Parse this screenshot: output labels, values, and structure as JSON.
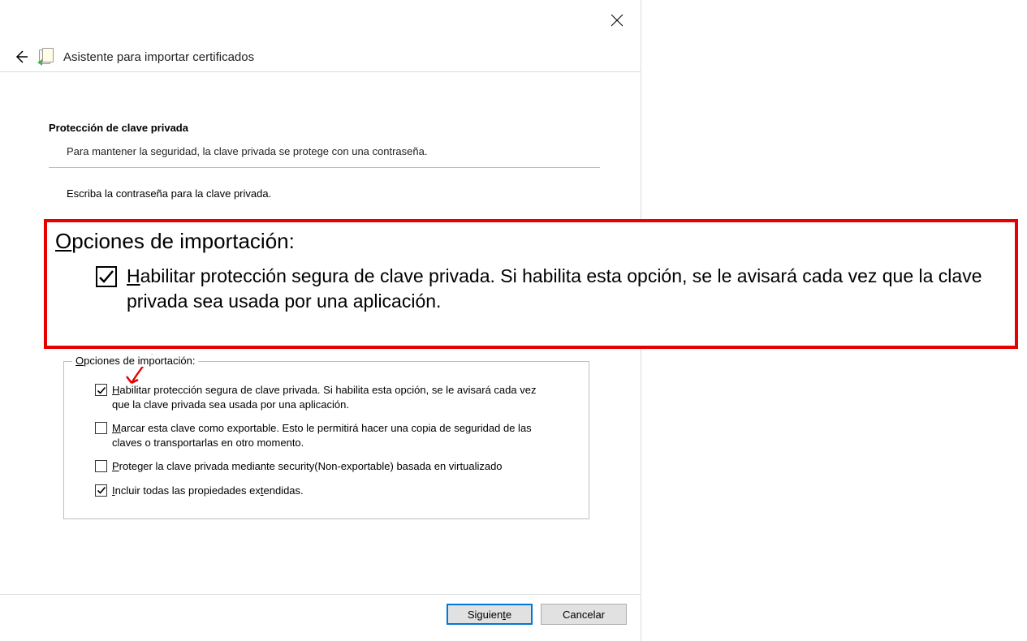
{
  "wizard": {
    "title": "Asistente para importar certificados",
    "section_title": "Protección de clave privada",
    "section_desc": "Para mantener la seguridad, la clave privada se protege con una contraseña.",
    "truncated_prompt": "Escriba la contraseña para la clave privada."
  },
  "zoom": {
    "legend_pre": "O",
    "legend_rest": "pciones de importación:",
    "option1_pre": "H",
    "option1_rest": "abilitar protección segura de clave privada. Si habilita esta opción, se le avisará cada vez que la clave privada sea usada por una aplicación."
  },
  "options": {
    "legend_pre": "O",
    "legend_rest": "pciones de importación:",
    "items": [
      {
        "checked": true,
        "pre": "H",
        "rest": "abilitar protección segura de clave privada. Si habilita esta opción, se le avisará cada vez que la clave privada sea usada por una aplicación."
      },
      {
        "checked": false,
        "pre": "M",
        "rest": "arcar esta clave como exportable. Esto le permitirá hacer una copia de seguridad de las claves o transportarlas en otro momento."
      },
      {
        "checked": false,
        "pre": "P",
        "rest": "roteger la clave privada mediante security(Non-exportable) basada en virtualizado"
      },
      {
        "checked": true,
        "pre": "I",
        "rest": "ncluir todas las propiedades ex",
        "mid": "t",
        "tail": "endidas."
      }
    ]
  },
  "footer": {
    "next_pre": "Siguien",
    "next_ul": "t",
    "next_post": "e",
    "cancel": "Cancelar"
  }
}
